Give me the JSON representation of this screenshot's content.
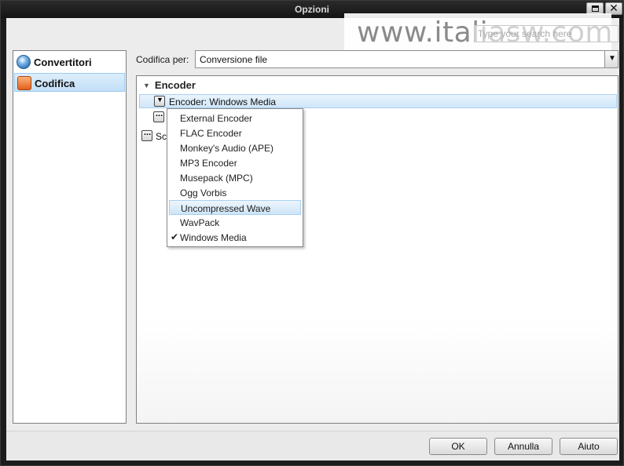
{
  "window": {
    "title": "Opzioni"
  },
  "watermark": {
    "text": "www.italiasw.com"
  },
  "search": {
    "placeholder": "Type your search here"
  },
  "sidebar": {
    "items": [
      {
        "label": "Convertitori",
        "icon": "globe-icon"
      },
      {
        "label": "Codifica",
        "icon": "wave-icon",
        "selected": true
      }
    ]
  },
  "codifica": {
    "label": "Codifica per:",
    "selected": "Conversione file"
  },
  "encoder_section": {
    "header": "Encoder",
    "row_label": "Encoder: Windows Media",
    "partial_label": "Sca"
  },
  "encoder_menu": {
    "items": [
      {
        "label": "External Encoder"
      },
      {
        "label": "FLAC Encoder"
      },
      {
        "label": "Monkey's Audio (APE)"
      },
      {
        "label": "MP3 Encoder"
      },
      {
        "label": "Musepack (MPC)"
      },
      {
        "label": "Ogg Vorbis"
      },
      {
        "label": "Uncompressed Wave",
        "highlighted": true
      },
      {
        "label": "WavPack"
      },
      {
        "label": "Windows Media",
        "checked": true
      }
    ]
  },
  "buttons": {
    "ok": "OK",
    "annulla": "Annulla",
    "aiuto": "Aiuto"
  }
}
